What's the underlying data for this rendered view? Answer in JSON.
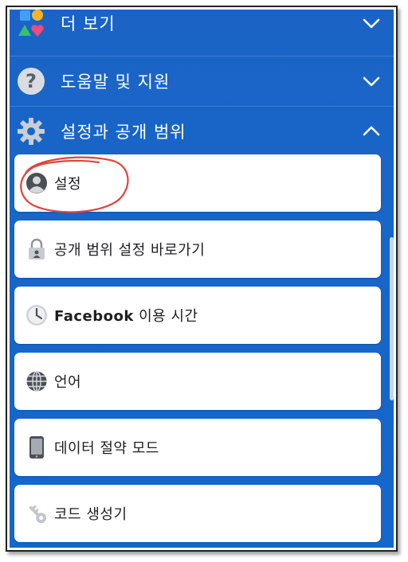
{
  "sections": {
    "more": {
      "label": "더 보기",
      "icon": "apps-shapes-icon",
      "chevron": "chevron-down"
    },
    "help": {
      "label": "도움말 및 지원",
      "icon": "question-icon",
      "chevron": "chevron-down"
    },
    "settings": {
      "label": "설정과 공개 범위",
      "icon": "gear-icon",
      "chevron": "chevron-up"
    }
  },
  "settings_items": [
    {
      "label": "설정",
      "icon": "profile-icon"
    },
    {
      "label": "공개 범위 설정 바로가기",
      "icon": "lock-icon"
    },
    {
      "label_bold": "Facebook",
      "label": " 이용 시간",
      "icon": "clock-icon"
    },
    {
      "label": "언어",
      "icon": "globe-icon"
    },
    {
      "label": "데이터 절약 모드",
      "icon": "phone-icon"
    },
    {
      "label": "코드 생성기",
      "icon": "key-icon"
    }
  ],
  "colors": {
    "background": "#1766c8",
    "card": "#ffffff",
    "annotation": "#e0443a"
  }
}
